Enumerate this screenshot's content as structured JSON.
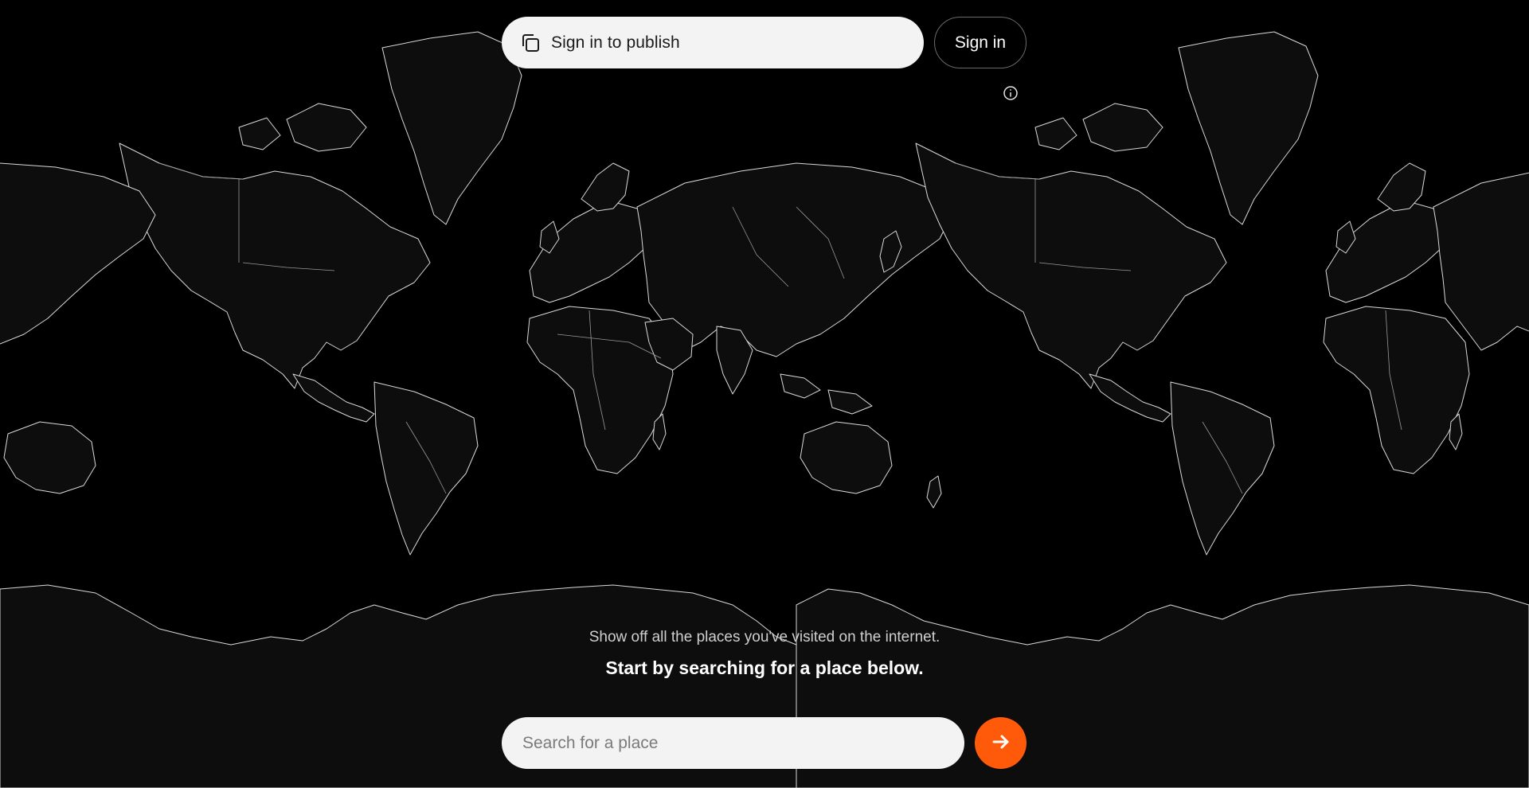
{
  "header": {
    "publish_label": "Sign in to publish",
    "signin_label": "Sign in"
  },
  "intro": {
    "subtitle": "Show off all the places you've visited on the internet.",
    "title": "Start by searching for a place below."
  },
  "search": {
    "placeholder": "Search for a place",
    "value": ""
  },
  "icons": {
    "publish": "copy-icon",
    "info": "info-icon",
    "submit": "arrow-right-icon"
  },
  "colors": {
    "background": "#000000",
    "accent": "#ff5a0a",
    "pill": "#f3f3f3",
    "map_outline": "#d9d9d9",
    "land_fill": "#0d0d0d"
  }
}
